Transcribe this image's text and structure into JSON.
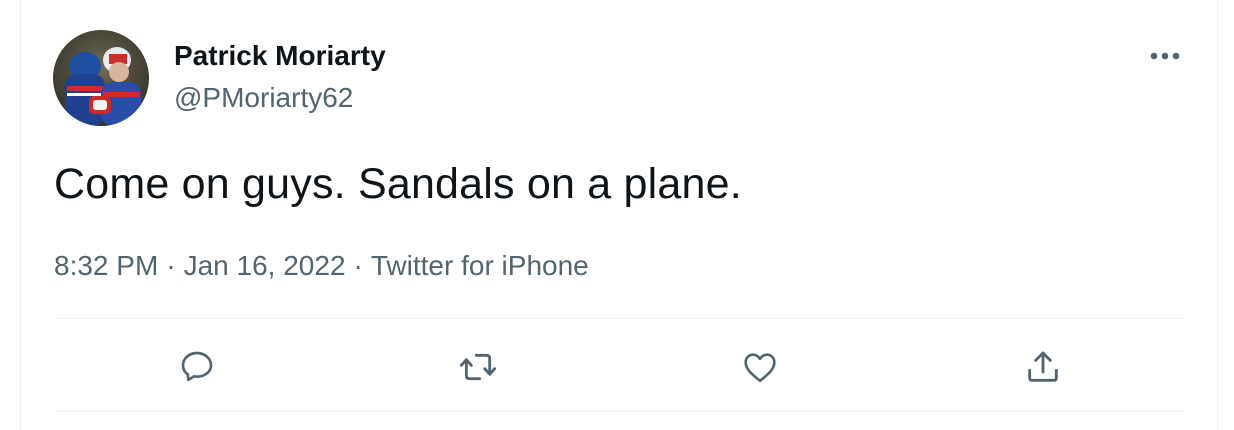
{
  "tweet": {
    "author": {
      "display_name": "Patrick Moriarty",
      "handle": "@PMoriarty62",
      "avatar_icon": "avatar-photo"
    },
    "text": "Come on guys. Sandals on a plane.",
    "meta": {
      "time": "8:32 PM",
      "separator": "·",
      "date": "Jan 16, 2022",
      "source": "Twitter for iPhone"
    },
    "more_icon": "more-horizontal-icon",
    "actions": [
      {
        "name": "reply",
        "icon": "reply-icon"
      },
      {
        "name": "retweet",
        "icon": "retweet-icon"
      },
      {
        "name": "like",
        "icon": "heart-icon"
      },
      {
        "name": "share",
        "icon": "share-icon"
      }
    ]
  },
  "colors": {
    "text_primary": "#0f1419",
    "text_secondary": "#536471",
    "border": "#eff3f4",
    "icon": "#536471"
  }
}
